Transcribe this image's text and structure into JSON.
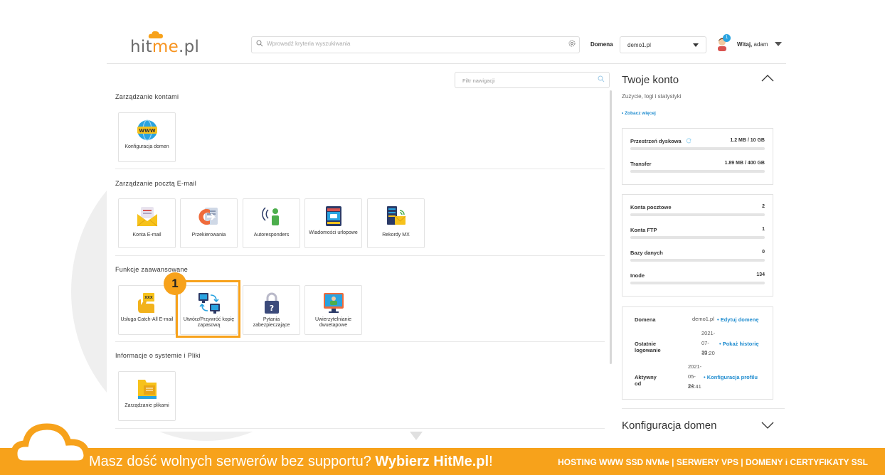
{
  "header": {
    "logo_text_a": "hit",
    "logo_text_b": "me",
    "logo_text_c": ".pl",
    "search_placeholder": "Wprowadź kryteria wyszukiwania",
    "domain_label": "Domena",
    "domain_value": "demo1.pl",
    "notification_count": "1",
    "welcome_prefix": "Witaj,",
    "welcome_user": "adam"
  },
  "nav_filter": {
    "placeholder": "Filtr nawigacji"
  },
  "sections": [
    {
      "title": "Zarządzanie kontami",
      "tiles": [
        {
          "label": "Konfiguracja domen",
          "icon": "www-globe-icon"
        }
      ]
    },
    {
      "title": "Zarządzanie pocztą E-mail",
      "tiles": [
        {
          "label": "Konta E-mail",
          "icon": "envelope-icon"
        },
        {
          "label": "Przekierowania",
          "icon": "forward-icon"
        },
        {
          "label": "Autoresponders",
          "icon": "autoresponder-icon"
        },
        {
          "label": "Wiadomości urlopowe",
          "icon": "vacation-message-icon"
        },
        {
          "label": "Rekordy MX",
          "icon": "mx-server-icon"
        }
      ]
    },
    {
      "title": "Funkcje zaawansowane",
      "tiles": [
        {
          "label": "Usługa Catch-All E-mail",
          "icon": "catch-all-icon"
        },
        {
          "label": "Utwórz/Przywróć kopię zapasową",
          "icon": "backup-icon"
        },
        {
          "label": "Pytania zabezpieczające",
          "icon": "security-question-icon"
        },
        {
          "label": "Uwierzytelnianie dwuetapowe",
          "icon": "two-factor-icon"
        }
      ]
    },
    {
      "title": "Informacje o systemie i Pliki",
      "tiles": [
        {
          "label": "Zarządzanie plikami",
          "icon": "folder-icon"
        }
      ]
    }
  ],
  "step_badge": "1",
  "account": {
    "title": "Twoje konto",
    "subtitle": "Zużycie, logi i statystyki",
    "see_more": "• Zobacz więcej",
    "usage": [
      {
        "label": "Przestrzeń dyskowa",
        "value": "1.2 MB / 10 GB",
        "fraction": 0.0001
      },
      {
        "label": "Transfer",
        "value": "1.89 MB / 400 GB",
        "fraction": 0.0001
      }
    ],
    "counts": [
      {
        "label": "Konta pocztowe",
        "value": "2"
      },
      {
        "label": "Konta FTP",
        "value": "1"
      },
      {
        "label": "Bazy danych",
        "value": "0"
      },
      {
        "label": "Inode",
        "value": "134"
      }
    ],
    "info": {
      "domain_label": "Domena",
      "domain_value": "demo1.pl",
      "domain_link": "• Edytuj domenę",
      "last_login_label": "Ostatnie logowanie",
      "last_login_l1": "2021-",
      "last_login_l2": "07-20",
      "last_login_l3": "13:20",
      "last_login_link": "• Pokaż historię",
      "active_label": "Aktywny od",
      "active_l1": "2021-",
      "active_l2": "05-24",
      "active_l3": "23:41",
      "active_link": "• Konfiguracja profilu"
    },
    "domain_config_title": "Konfiguracja domen"
  },
  "footer": {
    "promo_text": "Masz dość wolnych serwerów bez supportu? ",
    "promo_bold": "Wybierz HitMe.pl",
    "promo_end": "!",
    "links": "HOSTING WWW SSD NVMe | SERWERY VPS | DOMENY i CERTYFIKATY SSL"
  },
  "colors": {
    "accent": "#f7a21b",
    "link": "#1f8ccf",
    "badge": "#29a3e0"
  }
}
